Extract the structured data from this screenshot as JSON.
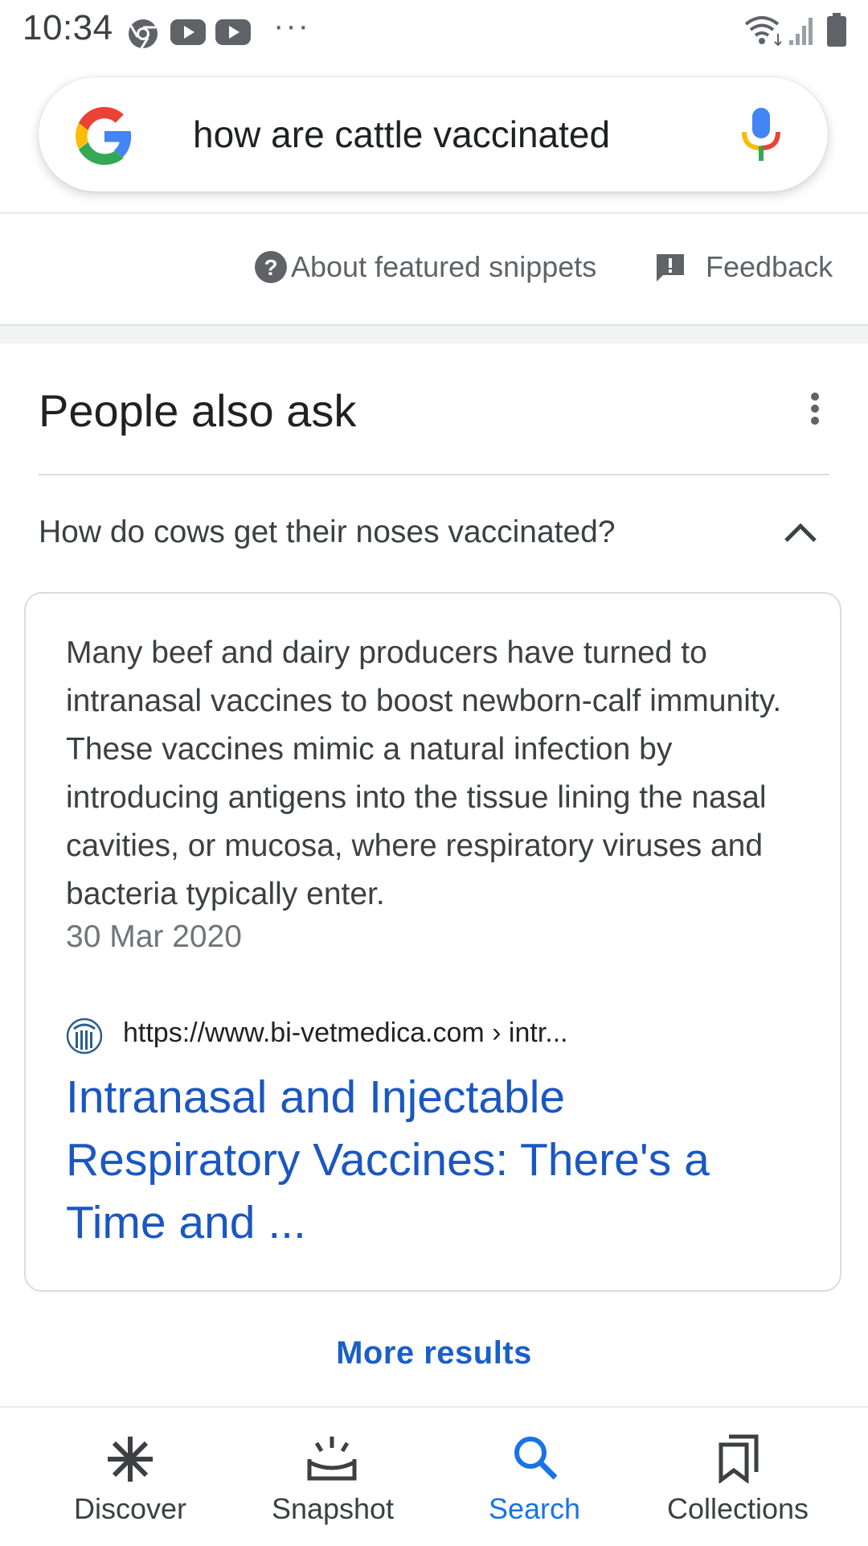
{
  "status_bar": {
    "time": "10:34",
    "app_icons": [
      "chrome-icon",
      "youtube-icon",
      "youtube-icon"
    ],
    "more": "···",
    "system_icons": [
      "wifi-icon",
      "signal-icon",
      "battery-icon"
    ]
  },
  "search": {
    "query": "how are cattle vaccinated"
  },
  "snippet_footer": {
    "about_label": "About featured snippets",
    "feedback_label": "Feedback"
  },
  "paa": {
    "title": "People also ask",
    "question": "How do cows get their noses vaccinated?",
    "answer": {
      "text": "Many beef and dairy producers have turned to intranasal vaccines to boost newborn-calf immunity. These vaccines mimic a natural infection by introducing antigens into the tissue lining the nasal cavities, or mucosa, where respiratory viruses and bacteria typically enter.",
      "date": "30 Mar 2020",
      "source_url": "https://www.bi-vetmedica.com › intr...",
      "result_title": "Intranasal and Injectable Respiratory Vaccines: There's a Time and ..."
    },
    "more_results": "More results"
  },
  "bottom_nav": {
    "items": [
      {
        "label": "Discover",
        "icon": "asterisk-icon",
        "active": false
      },
      {
        "label": "Snapshot",
        "icon": "snapshot-icon",
        "active": false
      },
      {
        "label": "Search",
        "icon": "search-icon",
        "active": true
      },
      {
        "label": "Collections",
        "icon": "bookmarks-icon",
        "active": false
      }
    ]
  },
  "colors": {
    "link": "#1a57c2",
    "active_nav": "#1a73e8",
    "text_secondary": "#5f6368"
  }
}
